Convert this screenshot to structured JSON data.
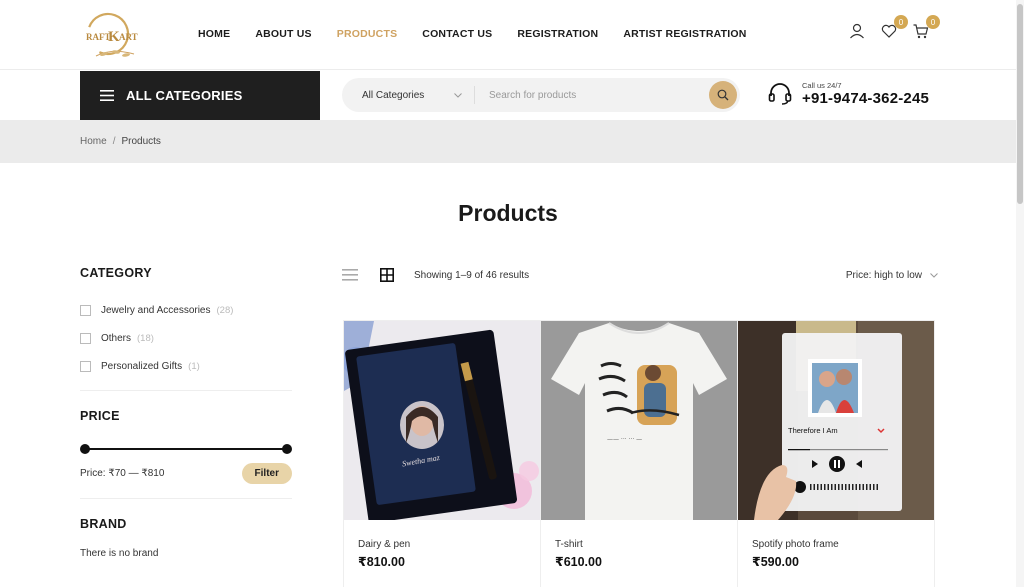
{
  "header": {
    "logo_text": "KRAFT KART",
    "nav": [
      "HOME",
      "ABOUT US",
      "PRODUCTS",
      "CONTACT US",
      "REGISTRATION",
      "ARTIST REGISTRATION"
    ],
    "active_nav": "PRODUCTS",
    "wishlist_count": "0",
    "cart_count": "0",
    "icons": [
      "user-icon",
      "heart-icon",
      "cart-icon"
    ]
  },
  "catbar": {
    "label": "ALL CATEGORIES"
  },
  "search": {
    "category_select": "All Categories",
    "placeholder": "Search for products"
  },
  "contact": {
    "caption": "Call us 24/7",
    "phone": "+91-9474-362-245"
  },
  "breadcrumb": {
    "home": "Home",
    "separator": "/",
    "current": "Products"
  },
  "page_title": "Products",
  "sidebar": {
    "category_heading": "CATEGORY",
    "categories": [
      {
        "label": "Jewelry and Accessories",
        "count": "(28)"
      },
      {
        "label": "Others",
        "count": "(18)"
      },
      {
        "label": "Personalized Gifts",
        "count": "(1)"
      }
    ],
    "price_heading": "PRICE",
    "price_text": "Price: ₹70 — ₹810",
    "price_min": 70,
    "price_max": 810,
    "filter_label": "Filter",
    "brand_heading": "BRAND",
    "brand_text": "There is no brand"
  },
  "toolbar": {
    "result_count": "Showing 1–9 of 46 results",
    "sort_label": "Price: high to low"
  },
  "products": [
    {
      "name": "Dairy & pen",
      "price": "₹810.00"
    },
    {
      "name": "T-shirt",
      "price": "₹610.00"
    },
    {
      "name": "Spotify photo frame",
      "price": "₹590.00"
    }
  ],
  "colors": {
    "accent": "#cfa261",
    "dark": "#1f1f1f",
    "filter_btn": "#e8d4a8",
    "breadcrumb_bg": "#ebebeb"
  }
}
